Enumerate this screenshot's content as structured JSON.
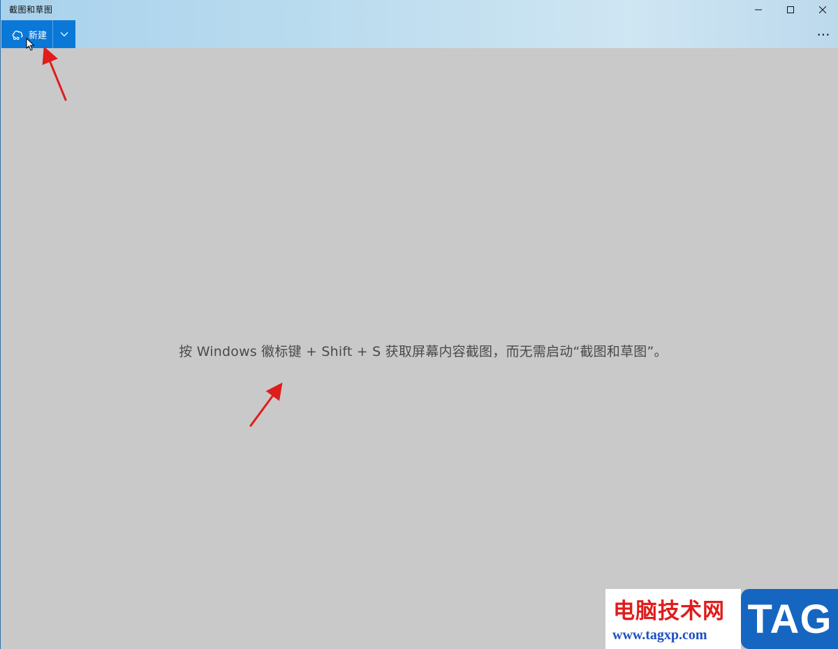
{
  "window": {
    "title": "截图和草图",
    "controls": {
      "minimize_icon": "minimize-icon",
      "maximize_icon": "maximize-icon",
      "close_icon": "close-icon"
    }
  },
  "toolbar": {
    "new_label": "新建",
    "new_icon": "snip-icon",
    "dropdown_icon": "chevron-down-icon",
    "more_label": "···"
  },
  "main": {
    "hint": "按 Windows 徽标键 + Shift + S 获取屏幕内容截图，而无需启动“截图和草图”。"
  },
  "watermark": {
    "site_name": "电脑技术网",
    "url": "www.tagxp.com",
    "tag": "TAG"
  },
  "colors": {
    "accent": "#0a78d7",
    "canvas": "#c9c9c9",
    "annotation_arrow": "#e01c1c",
    "watermark_red": "#e01c1c",
    "watermark_blue": "#1566c0"
  }
}
